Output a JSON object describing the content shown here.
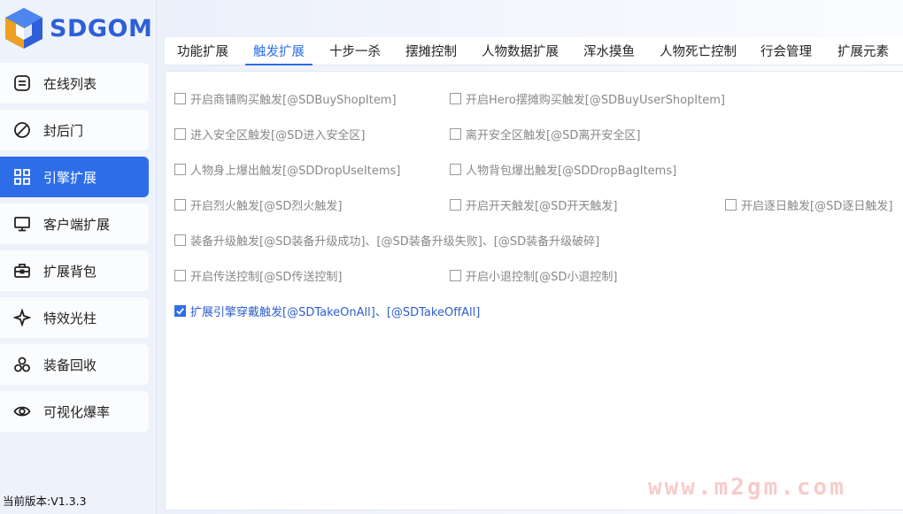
{
  "app": {
    "logo_text": "SDGOM",
    "version": "当前版本:V1.3.3"
  },
  "sidebar": {
    "items": [
      {
        "label": "在线列表",
        "icon": "list-icon"
      },
      {
        "label": "封后门",
        "icon": "ban-icon"
      },
      {
        "label": "引擎扩展",
        "icon": "grid-icon",
        "active": true
      },
      {
        "label": "客户端扩展",
        "icon": "monitor-icon"
      },
      {
        "label": "扩展背包",
        "icon": "bag-icon"
      },
      {
        "label": "特效光柱",
        "icon": "sparkle-icon"
      },
      {
        "label": "装备回收",
        "icon": "recycle-icon"
      },
      {
        "label": "可视化爆率",
        "icon": "eye-icon"
      }
    ]
  },
  "tabs": [
    "功能扩展",
    "触发扩展",
    "十步一杀",
    "摆摊控制",
    "人物数据扩展",
    "浑水摸鱼",
    "人物死亡控制",
    "行会管理",
    "扩展元素"
  ],
  "active_tab": "触发扩展",
  "options": [
    {
      "label": "开启商铺购买触发[@SDBuyShopItem]",
      "checked": false
    },
    {
      "label": "开启Hero摆摊购买触发[@SDBuyUserShopItem]",
      "checked": false
    },
    {
      "label": "进入安全区触发[@SD进入安全区]",
      "checked": false
    },
    {
      "label": "离开安全区触发[@SD离开安全区]",
      "checked": false
    },
    {
      "label": "人物身上爆出触发[@SDDropUseItems]",
      "checked": false
    },
    {
      "label": "人物背包爆出触发[@SDDropBagItems]",
      "checked": false
    },
    {
      "label": "开启烈火触发[@SD烈火触发]",
      "checked": false
    },
    {
      "label": "开启开天触发[@SD开天触发]",
      "checked": false
    },
    {
      "label": "开启逐日触发[@SD逐日触发]",
      "checked": false
    },
    {
      "label": "装备升级触发[@SD装备升级成功]、[@SD装备升级失败]、[@SD装备升级破碎]",
      "checked": false
    },
    {
      "label": "开启传送控制[@SD传送控制]",
      "checked": false
    },
    {
      "label": "开启小退控制[@SD小退控制]",
      "checked": false
    },
    {
      "label": "扩展引擎穿戴触发[@SDTakeOnAll]、[@SDTakeOffAll]",
      "checked": true
    }
  ],
  "watermark": "www.m2gm.com",
  "colors": {
    "accent": "#2d6ee8",
    "logo": "#2d5fd6"
  }
}
